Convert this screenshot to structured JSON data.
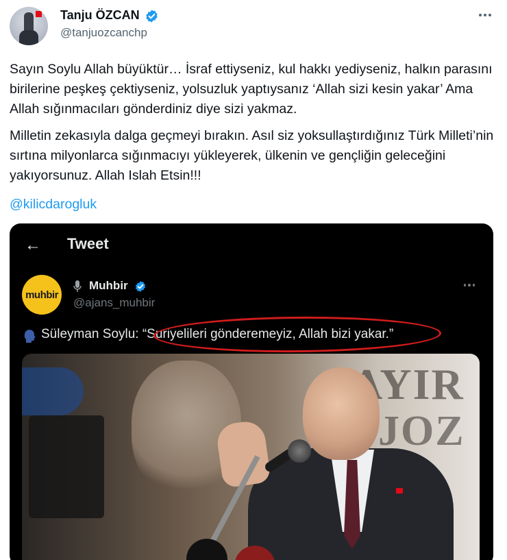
{
  "author": {
    "name": "Tanju ÖZCAN",
    "handle": "@tanjuozcanchp",
    "verified": true
  },
  "tweet": {
    "paragraph1": "Sayın Soylu Allah büyüktür… İsraf ettiyseniz, kul hakkı yediyseniz, halkın parasını birilerine peşkeş çektiyseniz, yolsuzluk yaptıysanız ‘Allah sizi kesin yakar’ Ama Allah sığınmacıları gönderdiniz diye sizi yakmaz.",
    "paragraph2": "Milletin zekasıyla dalga geçmeyi bırakın. Asıl siz yoksullaştırdığınız Türk Milleti’nin sırtına milyonlarca sığınmacıyı yükleyerek, ülkenin ve gençliğin geleceğini yakıyorsunuz. Allah Islah Etsin!!!",
    "mention": "@kilicdarogluk"
  },
  "embedded": {
    "header_title": "Tweet",
    "author_name": "Muhbir",
    "author_handle": "@ajans_muhbir",
    "avatar_text": "muhbir",
    "quote_speaker": "Süleyman Soylu: ",
    "quote_text": "“Suriyelileri gönderemeyiz, Allah bizi yakar.”",
    "photo_text_top": "AYIR",
    "photo_text_bottom": "JOZ"
  },
  "icons": {
    "verified": "verified-badge-icon",
    "more": "more-options-icon",
    "back": "back-arrow-icon",
    "mic": "microphone-icon",
    "speaking": "speaking-head-icon"
  },
  "colors": {
    "link": "#1d9bf0",
    "verified": "#1d9bf0",
    "highlight_ring": "#d01c1c",
    "muhbir_yellow": "#f5c21c"
  }
}
